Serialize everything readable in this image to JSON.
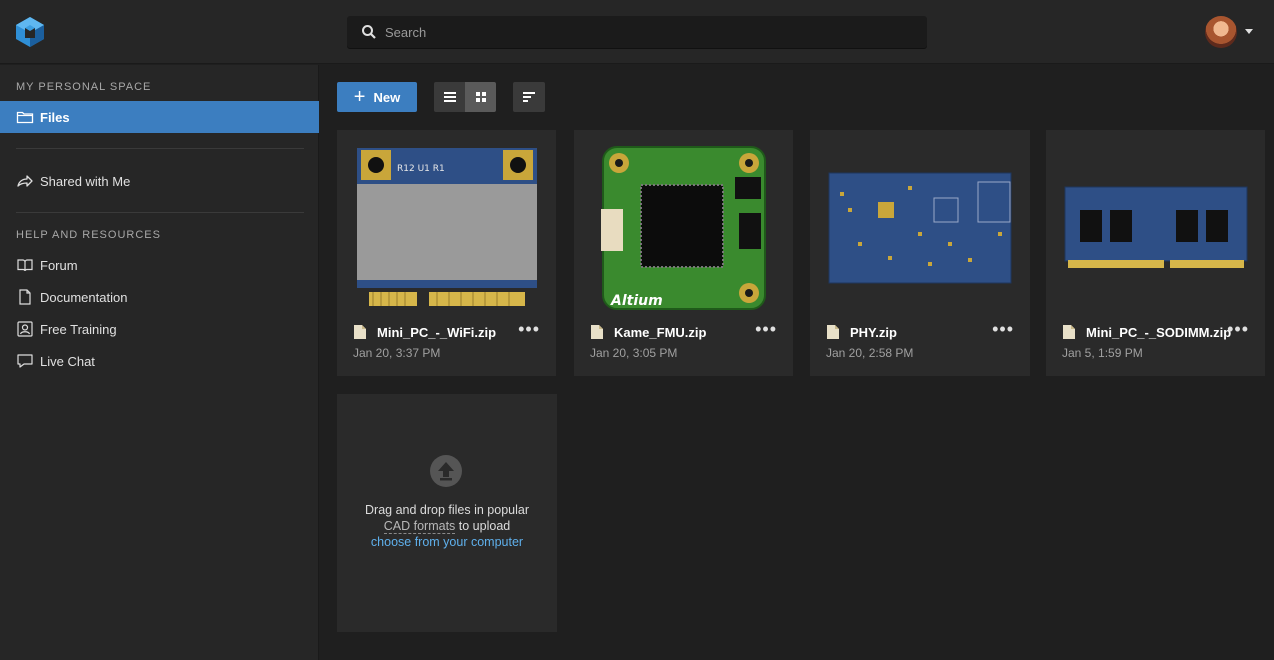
{
  "search": {
    "placeholder": "Search"
  },
  "sidebar": {
    "section1": "MY PERSONAL SPACE",
    "files": "Files",
    "shared": "Shared with Me",
    "section2": "HELP AND RESOURCES",
    "help": [
      {
        "label": "Forum",
        "icon": "book-icon"
      },
      {
        "label": "Documentation",
        "icon": "document-icon"
      },
      {
        "label": "Free Training",
        "icon": "training-icon"
      },
      {
        "label": "Live Chat",
        "icon": "chat-icon"
      }
    ]
  },
  "toolbar": {
    "new_label": "New"
  },
  "files": [
    {
      "name": "Mini_PC_-_WiFi.zip",
      "date": "Jan 20, 3:37 PM"
    },
    {
      "name": "Kame_FMU.zip",
      "date": "Jan 20, 3:05 PM"
    },
    {
      "name": "PHY.zip",
      "date": "Jan 20, 2:58 PM"
    },
    {
      "name": "Mini_PC_-_SODIMM.zip",
      "date": "Jan 5, 1:59 PM"
    }
  ],
  "upload": {
    "line1": "Drag and drop files in popular",
    "cad": "CAD formats",
    "line2b": " to upload",
    "link": "choose from your computer"
  },
  "colors": {
    "accent": "#3c7ec0",
    "link": "#5fb0ec",
    "board_green": "#3a8a2e",
    "board_blue": "#2e4f86"
  }
}
